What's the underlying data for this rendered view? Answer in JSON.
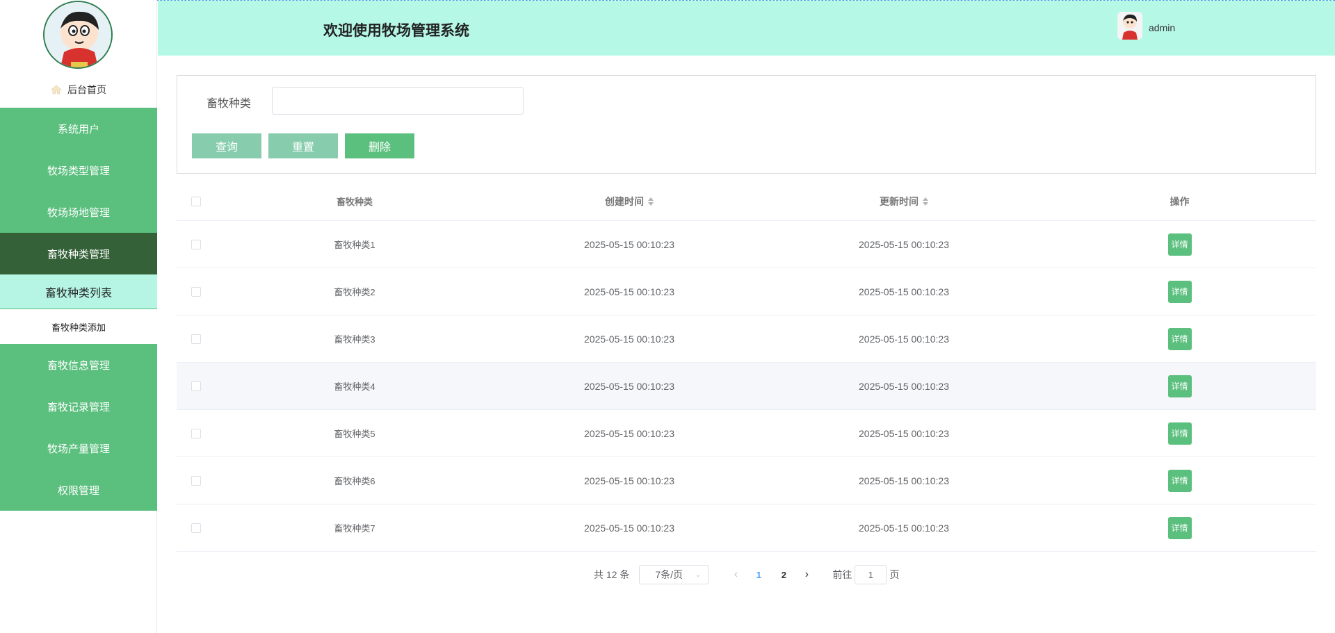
{
  "colors": {
    "menu_bg": "#5bbf7e",
    "menu_active_bg": "#356138",
    "header_bg": "#b6f8e6",
    "submenu_current_bg": "#b6f5e3",
    "primary_button": "#5bbf7e",
    "muted_button": "#86ccad",
    "page_active": "#409eff"
  },
  "sidebar": {
    "avatar_icon": "cartoon-avatar",
    "home_label": "后台首页",
    "menu": [
      {
        "label": "系统用户"
      },
      {
        "label": "牧场类型管理"
      },
      {
        "label": "牧场场地管理"
      },
      {
        "label": "畜牧种类管理"
      },
      {
        "label": "畜牧种类列表"
      },
      {
        "label": "畜牧种类添加"
      },
      {
        "label": "畜牧信息管理"
      },
      {
        "label": "畜牧记录管理"
      },
      {
        "label": "牧场产量管理"
      },
      {
        "label": "权限管理"
      }
    ]
  },
  "header": {
    "title": "欢迎使用牧场管理系统",
    "username": "admin"
  },
  "search": {
    "label": "畜牧种类",
    "value": "",
    "query_label": "查询",
    "reset_label": "重置",
    "delete_label": "删除"
  },
  "table": {
    "columns": [
      "畜牧种类",
      "创建时间",
      "更新时间",
      "操作"
    ],
    "detail_label": "详情",
    "rows": [
      {
        "name": "畜牧种类1",
        "created": "2025-05-15 00:10:23",
        "updated": "2025-05-15 00:10:23"
      },
      {
        "name": "畜牧种类2",
        "created": "2025-05-15 00:10:23",
        "updated": "2025-05-15 00:10:23"
      },
      {
        "name": "畜牧种类3",
        "created": "2025-05-15 00:10:23",
        "updated": "2025-05-15 00:10:23"
      },
      {
        "name": "畜牧种类4",
        "created": "2025-05-15 00:10:23",
        "updated": "2025-05-15 00:10:23"
      },
      {
        "name": "畜牧种类5",
        "created": "2025-05-15 00:10:23",
        "updated": "2025-05-15 00:10:23"
      },
      {
        "name": "畜牧种类6",
        "created": "2025-05-15 00:10:23",
        "updated": "2025-05-15 00:10:23"
      },
      {
        "name": "畜牧种类7",
        "created": "2025-05-15 00:10:23",
        "updated": "2025-05-15 00:10:23"
      }
    ]
  },
  "pagination": {
    "total_text": "共 12 条",
    "page_size": "7条/页",
    "pages": [
      "1",
      "2"
    ],
    "current_page": "1",
    "goto_prefix": "前往",
    "goto_value": "1",
    "goto_suffix": "页"
  }
}
